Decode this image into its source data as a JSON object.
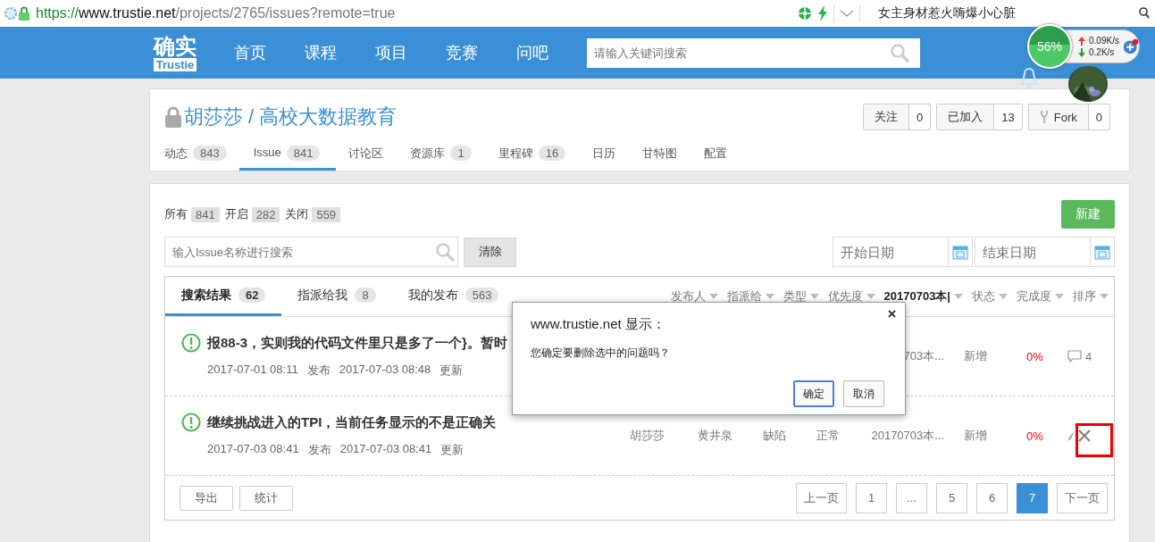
{
  "browser": {
    "url_scheme": "https://",
    "url_host": "www.trustie.net",
    "url_path": "/projects/2765/issues?remote=true",
    "suggestion": "女主身材惹火嗨爆小心脏"
  },
  "navbar": {
    "logo": {
      "top": "确实",
      "bottom": "Trustie"
    },
    "items": [
      {
        "label": "首页"
      },
      {
        "label": "课程"
      },
      {
        "label": "项目"
      },
      {
        "label": "竞赛"
      },
      {
        "label": "问吧"
      }
    ],
    "search": {
      "placeholder": "请输入关键词搜索"
    }
  },
  "net_widget": {
    "percent": "56%",
    "upload": "0.09K/s",
    "download": "0.2K/s"
  },
  "project": {
    "title": "胡莎莎 / 高校大数据教育",
    "private": true,
    "actions": [
      {
        "kind": "plain",
        "label": "关注",
        "count": "0"
      },
      {
        "kind": "plain",
        "label": "已加入",
        "count": "13"
      },
      {
        "kind": "fork",
        "label": "Fork",
        "count": "0"
      }
    ],
    "tabs": [
      {
        "label": "动态",
        "count": "843",
        "selected": false
      },
      {
        "label": "Issue",
        "count": "841",
        "selected": true
      },
      {
        "label": "讨论区",
        "selected": false
      },
      {
        "label": "资源库",
        "count": "1",
        "selected": false
      },
      {
        "label": "里程碑",
        "count": "16",
        "selected": false
      },
      {
        "label": "日历",
        "selected": false
      },
      {
        "label": "甘特图",
        "selected": false
      },
      {
        "label": "配置",
        "selected": false
      }
    ]
  },
  "issues": {
    "summary": [
      {
        "label": "所有",
        "count": "841"
      },
      {
        "label": "开启",
        "count": "282"
      },
      {
        "label": "关闭",
        "count": "559"
      }
    ],
    "new_button": "新建",
    "search": {
      "placeholder": "输入Issue名称进行搜索"
    },
    "clear_button": "清除",
    "start_date": {
      "placeholder": "开始日期"
    },
    "end_date": {
      "placeholder": "结束日期"
    },
    "tabs": [
      {
        "label": "搜索结果",
        "count": "62",
        "selected": true
      },
      {
        "label": "指派给我",
        "count": "8",
        "selected": false
      },
      {
        "label": "我的发布",
        "count": "563",
        "selected": false
      }
    ],
    "filters": [
      {
        "label": "发布人",
        "bold": false
      },
      {
        "label": "指派给",
        "bold": false
      },
      {
        "label": "类型",
        "bold": false
      },
      {
        "label": "优先度",
        "bold": false
      },
      {
        "label": "20170703本|",
        "bold": true
      },
      {
        "label": "状态",
        "bold": false
      },
      {
        "label": "完成度",
        "bold": false
      },
      {
        "label": "排序",
        "bold": false
      }
    ],
    "rows": [
      {
        "title": "报88-3，实则我的代码文件里只是多了一个}。暂时",
        "created": "2017-07-01 08:11",
        "created_label": "发布",
        "updated": "2017-07-03 08:48",
        "updated_label": "更新",
        "cells": [
          "",
          "",
          "",
          "",
          "703本..."
        ],
        "status": "新增",
        "progress": "0%",
        "action": {
          "kind": "comments",
          "count": "4"
        }
      },
      {
        "title": "继续挑战进入的TPI，当前任务显示的不是正确关",
        "created": "2017-07-03 08:41",
        "created_label": "发布",
        "updated": "2017-07-03 08:41",
        "updated_label": "更新",
        "cells": [
          "胡莎莎",
          "黄井泉",
          "缺陷",
          "正常",
          "20170703本..."
        ],
        "status": "新增",
        "progress": "0%",
        "action": {
          "kind": "delete",
          "highlighted": true
        }
      }
    ],
    "footer_buttons": [
      "导出",
      "统计"
    ],
    "pages": [
      {
        "label": "上一页",
        "selected": false
      },
      {
        "label": "1",
        "selected": false
      },
      {
        "label": "...",
        "selected": false
      },
      {
        "label": "5",
        "selected": false
      },
      {
        "label": "6",
        "selected": false
      },
      {
        "label": "7",
        "selected": true
      },
      {
        "label": "下一页",
        "selected": false
      }
    ]
  },
  "dialog": {
    "title": "www.trustie.net 显示：",
    "message": "您确定要删除选中的问题吗？",
    "buttons": [
      {
        "label": "确定",
        "focused": true
      },
      {
        "label": "取消",
        "focused": false
      }
    ]
  }
}
